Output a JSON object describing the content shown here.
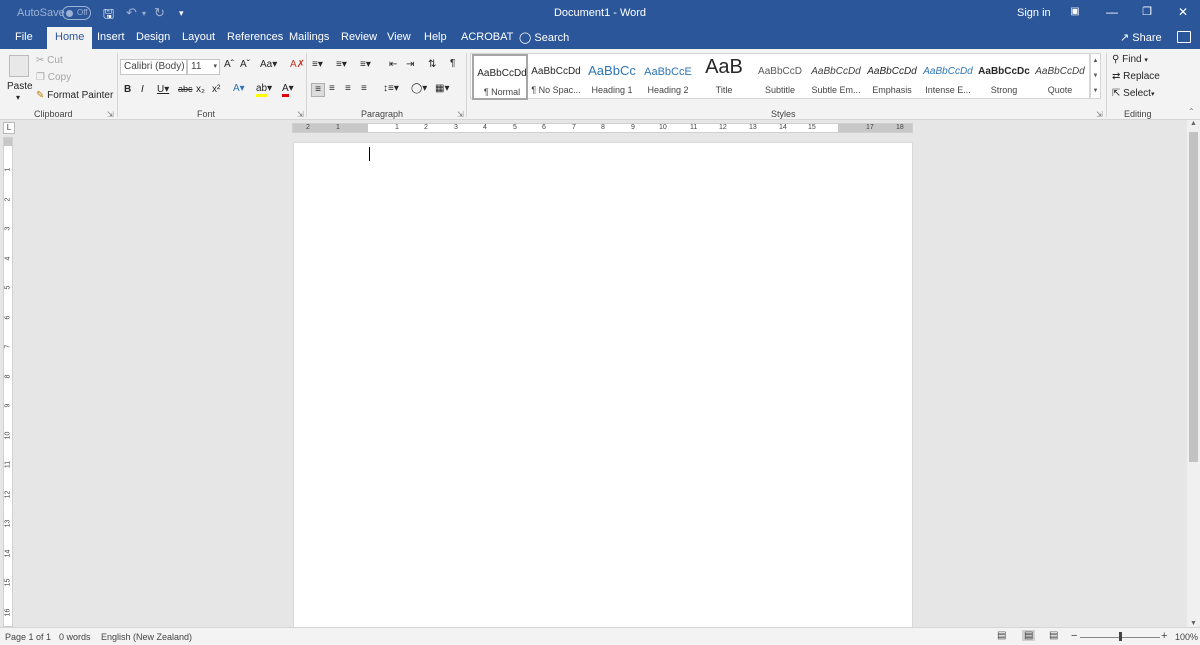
{
  "titlebar": {
    "autosave_label": "AutoSave",
    "autosave_state": "Off",
    "document_title": "Document1  -  Word",
    "sign_in": "Sign in"
  },
  "tabs": [
    "File",
    "Home",
    "Insert",
    "Design",
    "Layout",
    "References",
    "Mailings",
    "Review",
    "View",
    "Help",
    "ACROBAT"
  ],
  "active_tab": "Home",
  "search_label": "Search",
  "share_label": "Share",
  "clipboard": {
    "paste": "Paste",
    "cut": "Cut",
    "copy": "Copy",
    "format_painter": "Format Painter",
    "group_label": "Clipboard"
  },
  "font": {
    "font_name": "Calibri (Body)",
    "font_size": "11",
    "group_label": "Font"
  },
  "paragraph": {
    "group_label": "Paragraph"
  },
  "styles": {
    "group_label": "Styles",
    "items": [
      {
        "preview": "AaBbCcDd",
        "name": "¶ Normal"
      },
      {
        "preview": "AaBbCcDd",
        "name": "¶ No Spac..."
      },
      {
        "preview": "AaBbCc",
        "name": "Heading 1"
      },
      {
        "preview": "AaBbCcE",
        "name": "Heading 2"
      },
      {
        "preview": "AaB",
        "name": "Title"
      },
      {
        "preview": "AaBbCcD",
        "name": "Subtitle"
      },
      {
        "preview": "AaBbCcDd",
        "name": "Subtle Em..."
      },
      {
        "preview": "AaBbCcDd",
        "name": "Emphasis"
      },
      {
        "preview": "AaBbCcDd",
        "name": "Intense E..."
      },
      {
        "preview": "AaBbCcDc",
        "name": "Strong"
      },
      {
        "preview": "AaBbCcDd",
        "name": "Quote"
      }
    ]
  },
  "editing": {
    "find": "Find",
    "replace": "Replace",
    "select": "Select",
    "group_label": "Editing"
  },
  "ruler_numbers": [
    "2",
    "1",
    "1",
    "2",
    "3",
    "4",
    "5",
    "6",
    "7",
    "8",
    "9",
    "10",
    "11",
    "12",
    "13",
    "14",
    "15",
    "17",
    "18"
  ],
  "vruler_numbers": [
    "1",
    "2",
    "3",
    "4",
    "5",
    "6",
    "7",
    "8",
    "9",
    "10",
    "11",
    "12",
    "13",
    "14",
    "15",
    "16"
  ],
  "status": {
    "page": "Page 1 of 1",
    "words": "0 words",
    "language": "English (New Zealand)",
    "zoom": "100%",
    "zoom_level": 100
  },
  "colors": {
    "brand": "#2b579a",
    "ribbon": "#f3f3f3",
    "canvas": "#e6e6e6"
  }
}
